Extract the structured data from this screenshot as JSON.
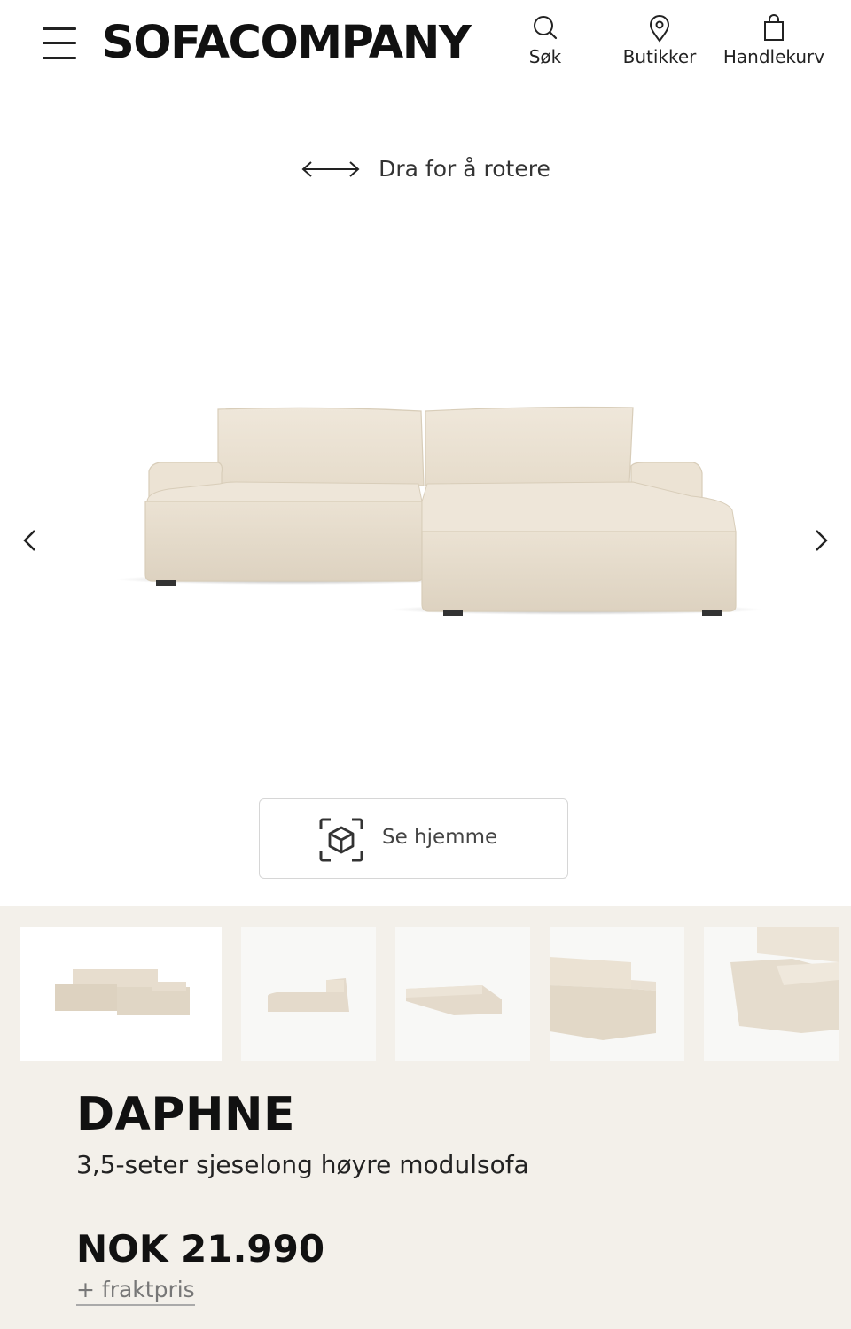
{
  "header": {
    "logo": "SOFACOMPANY",
    "nav": {
      "search_label": "Søk",
      "stores_label": "Butikker",
      "cart_label": "Handlekurv"
    }
  },
  "viewer": {
    "rotate_hint": "Dra for å rotere",
    "ar_button_label": "Se hjemme",
    "icons": [
      "menu-icon",
      "search-icon",
      "location-pin-icon",
      "shopping-bag-icon",
      "rotate-arrows-icon",
      "chevron-left-icon",
      "chevron-right-icon",
      "ar-cube-icon"
    ]
  },
  "gallery": {
    "thumbnail_count": 5,
    "active_index": 0
  },
  "product": {
    "name": "DAPHNE",
    "description": "3,5-seter sjeselong høyre modulsofa",
    "price": "NOK 21.990",
    "shipping": "+ fraktpris"
  },
  "colors": {
    "panel_background": "#f3f0ea",
    "sofa_fabric": "#ebe2d3"
  }
}
